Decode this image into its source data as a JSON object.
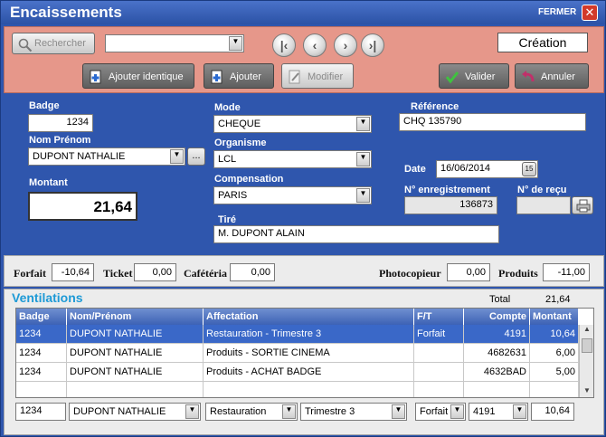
{
  "window": {
    "title": "Encaissements",
    "close_label": "FERMER",
    "close_glyph": "✕"
  },
  "toolbar": {
    "search_label": "Rechercher",
    "search_value": "",
    "mode_label": "Création",
    "add_same_label": "Ajouter identique",
    "add_label": "Ajouter",
    "edit_label": "Modifier",
    "validate_label": "Valider",
    "cancel_label": "Annuler",
    "nav": {
      "first": "|‹",
      "prev": "‹",
      "next": "›",
      "last": "›|"
    }
  },
  "form": {
    "badge_label": "Badge",
    "badge_value": "1234",
    "name_label": "Nom Prénom",
    "name_value": "DUPONT NATHALIE",
    "name_more": "...",
    "amount_label": "Montant",
    "amount_value": "21,64",
    "mode_label": "Mode",
    "mode_value": "CHEQUE",
    "org_label": "Organisme",
    "org_value": "LCL",
    "comp_label": "Compensation",
    "comp_value": "PARIS",
    "tire_label": "Tiré",
    "tire_value": "M. DUPONT ALAIN",
    "ref_label": "Référence",
    "ref_value": "CHQ 135790",
    "date_label": "Date",
    "date_value": "16/06/2014",
    "date_btn": "15",
    "enreg_label": "N° enregistrement",
    "enreg_value": "136873",
    "recu_label": "N° de reçu",
    "recu_value": ""
  },
  "totals": {
    "forfait_label": "Forfait",
    "forfait_value": "-10,64",
    "ticket_label": "Ticket",
    "ticket_value": "0,00",
    "cafeteria_label": "Cafétéria",
    "cafeteria_value": "0,00",
    "photo_label": "Photocopieur",
    "photo_value": "0,00",
    "produits_label": "Produits",
    "produits_value": "-11,00"
  },
  "ventilations": {
    "title": "Ventilations",
    "total_label": "Total",
    "total_value": "21,64",
    "columns": [
      "Badge",
      "Nom/Prénom",
      "Affectation",
      "F/T",
      "Compte",
      "Montant"
    ],
    "rows": [
      [
        "1234",
        "DUPONT NATHALIE",
        "Restauration - Trimestre 3",
        "Forfait",
        "4191",
        "10,64"
      ],
      [
        "1234",
        "DUPONT NATHALIE",
        "Produits - SORTIE CINEMA",
        "",
        "4682631",
        "6,00"
      ],
      [
        "1234",
        "DUPONT NATHALIE",
        "Produits - ACHAT BADGE",
        "",
        "4632BAD",
        "5,00"
      ]
    ],
    "edit": {
      "badge": "1234",
      "name": "DUPONT NATHALIE",
      "affectation": "Restauration",
      "periode": "Trimestre 3",
      "ft": "Forfait",
      "compte": "4191",
      "montant": "10,64"
    }
  }
}
